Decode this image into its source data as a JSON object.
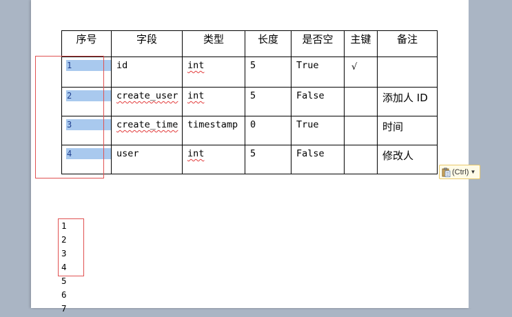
{
  "table": {
    "headers": [
      "序号",
      "字段",
      "类型",
      "长度",
      "是否空",
      "主键",
      "备注"
    ],
    "rows": [
      {
        "seq": "1",
        "field": "id",
        "type": "int",
        "length": "5",
        "nullable": "True",
        "pk": "√",
        "note": ""
      },
      {
        "seq": "2",
        "field": "create_user",
        "type": "int",
        "length": "5",
        "nullable": "False",
        "pk": "",
        "note": "添加人 ID"
      },
      {
        "seq": "3",
        "field": "create_time",
        "type": "timestamp",
        "length": "0",
        "nullable": "True",
        "pk": "",
        "note": "时间"
      },
      {
        "seq": "4",
        "field": "user",
        "type": "int",
        "length": "5",
        "nullable": "False",
        "pk": "",
        "note": "修改人"
      }
    ]
  },
  "paste_options": {
    "label": "(Ctrl)",
    "icon": "clipboard-icon",
    "dropdown_icon": "caret-down-icon"
  },
  "number_list": [
    "1",
    "2",
    "3",
    "4",
    "5",
    "6",
    "7"
  ],
  "colors": {
    "selection": "#a9c9ee",
    "annotation_box": "#e05050",
    "spellcheck": "#e23a3a",
    "page_background": "#ffffff",
    "workspace": "#aab5c4"
  }
}
